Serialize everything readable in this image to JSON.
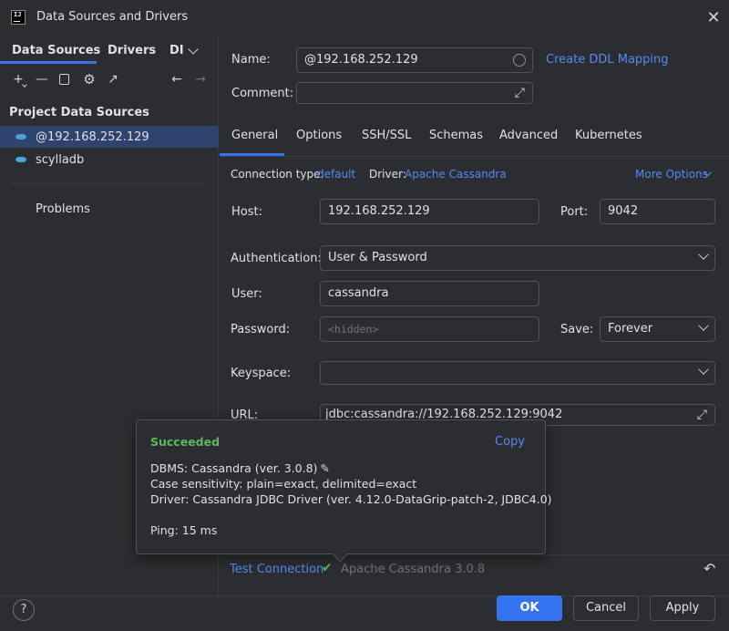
{
  "window": {
    "title": "Data Sources and Drivers",
    "logo_text": "IJ"
  },
  "left": {
    "tabs": [
      "Data Sources",
      "Drivers",
      "DI"
    ],
    "section_title": "Project Data Sources",
    "items": [
      {
        "label": "@192.168.252.129",
        "selected": true
      },
      {
        "label": "scylladb",
        "selected": false
      }
    ],
    "problems": "Problems"
  },
  "form": {
    "name_label": "Name:",
    "name_value": "@192.168.252.129",
    "ddl_link": "Create DDL Mapping",
    "comment_label": "Comment:",
    "comment_value": "",
    "tabs": [
      "General",
      "Options",
      "SSH/SSL",
      "Schemas",
      "Advanced",
      "Kubernetes"
    ],
    "connection_type_label": "Connection type:",
    "connection_type_value": "default",
    "driver_label": "Driver:",
    "driver_value": "Apache Cassandra",
    "more_options": "More Options",
    "host_label": "Host:",
    "host_value": "192.168.252.129",
    "port_label": "Port:",
    "port_value": "9042",
    "auth_label": "Authentication:",
    "auth_value": "User & Password",
    "user_label": "User:",
    "user_value": "cassandra",
    "password_label": "Password:",
    "password_placeholder": "<hidden>",
    "save_label": "Save:",
    "save_value": "Forever",
    "keyspace_label": "Keyspace:",
    "keyspace_value": "",
    "url_label": "URL:",
    "url_value": "jdbc:cassandra://192.168.252.129:9042"
  },
  "popup": {
    "status": "Succeeded",
    "copy": "Copy",
    "dbms": "DBMS: Cassandra (ver. 3.0.8)",
    "case": "Case sensitivity: plain=exact, delimited=exact",
    "driver": "Driver: Cassandra JDBC Driver (ver. 4.12.0-DataGrip-patch-2, JDBC4.0)",
    "ping": "Ping: 15 ms"
  },
  "bottom": {
    "test_connection": "Test Connection",
    "version": "Apache Cassandra 3.0.8"
  },
  "footer": {
    "help": "?",
    "ok": "OK",
    "cancel": "Cancel",
    "apply": "Apply"
  },
  "colors": {
    "accent": "#3574f0",
    "link": "#548af7",
    "success": "#5fb85f",
    "selection": "#2e436e"
  }
}
